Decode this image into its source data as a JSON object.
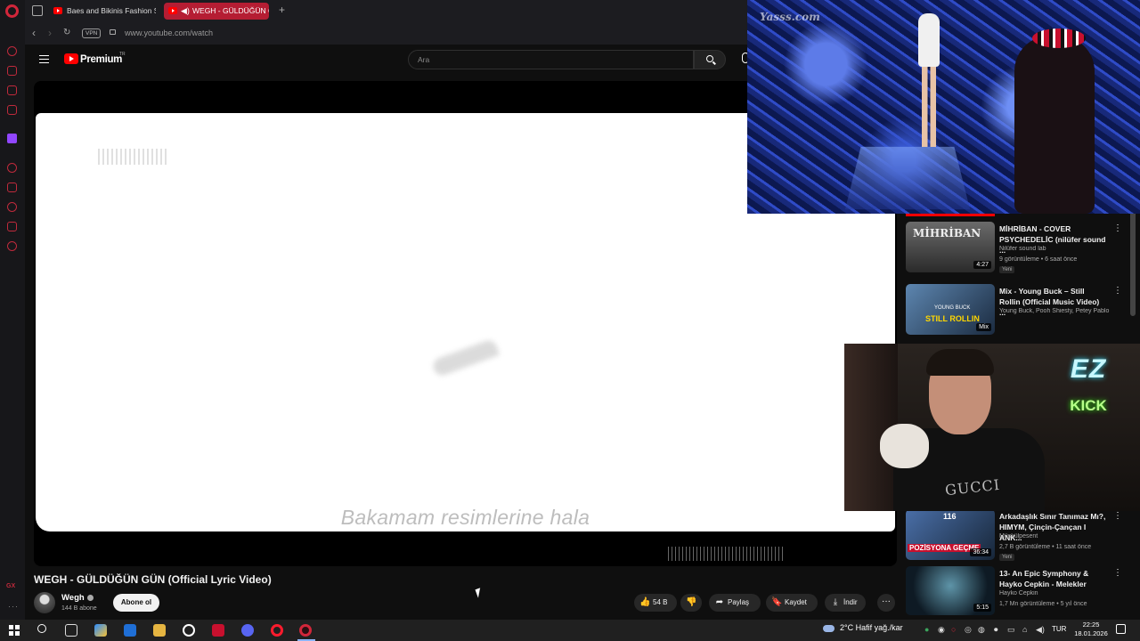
{
  "browser": {
    "tabs": [
      {
        "title": "Baes and Bikinis Fashion S",
        "active": false
      },
      {
        "title": "WEGH - GÜLDÜĞÜN G",
        "active": true
      }
    ],
    "new_tab": "+",
    "vpn_label": "VPN",
    "url": "www.youtube.com/watch",
    "sidebar_gx": "GX"
  },
  "youtube": {
    "brand": "Premium",
    "region": "TR",
    "search_placeholder": "Ara"
  },
  "player": {
    "lyric": "Bakamam resimlerine hala"
  },
  "video": {
    "title": "WEGH - GÜLDÜĞÜN GÜN (Official Lyric Video)",
    "channel": "Wegh",
    "subscribers": "144 B abone",
    "subscribe_label": "Abone ol",
    "likes": "54 B",
    "share_label": "Paylaş",
    "save_label": "Kaydet",
    "download_label": "İndir"
  },
  "recommendations": [
    {
      "title": "MİHRİBAN - COVER PSYCHEDELİC (nilüfer sound ...",
      "channel": "Nilüfer sound lab",
      "meta": "9 görüntüleme • 6 saat önce",
      "badge": "Yeni",
      "duration": "4:27",
      "thumb": "#3b3b3b"
    },
    {
      "title": "Mix - Young Buck – Still Rollin (Official Music Video) ...",
      "channel": "Young Buck, Pooh Shiesty, Petey Pablo v...",
      "meta": "",
      "badge": "",
      "duration": "Mix",
      "thumb": "#27435e"
    },
    {
      "title": "Arkadaşlık Sınır Tanımaz Mı?, HIMYM, Çinçin-Çançan I ANK...",
      "channel": "Müşkülpesent",
      "meta": "2,7 B görüntüleme • 11 saat önce",
      "badge": "Yeni",
      "duration": "36:34",
      "thumb": "#2c4d7a"
    },
    {
      "title": "13- An Epic Symphony & Hayko Cepkin - Melekler",
      "channel": "Hayko Cepkin",
      "meta": "1,7 Mn görüntüleme • 5 yıl önce",
      "badge": "",
      "duration": "5:15",
      "thumb": "#1d3346"
    }
  ],
  "thumb_text": {
    "mihriban": "MİHRİBAN",
    "still_rollin": "STILL ROLLIN",
    "young_buck": "YOUNG BUCK",
    "pozisyona": "POZİSYONA GEÇME",
    "num_116": "116"
  },
  "pip_fashion": {
    "watermark": "Yasss.com"
  },
  "pip_cam": {
    "neon_top": "EZ",
    "neon_bottom": "KICK",
    "shirt": "GUCCI"
  },
  "taskbar": {
    "weather": "2°C  Hafif yağ./kar",
    "lang": "TUR",
    "time": "22:25",
    "date": "18.01.2026"
  },
  "colors": {
    "opera_red": "#d1263a",
    "youtube_red": "#ff0000",
    "yt_bg": "#0f0f0f"
  }
}
